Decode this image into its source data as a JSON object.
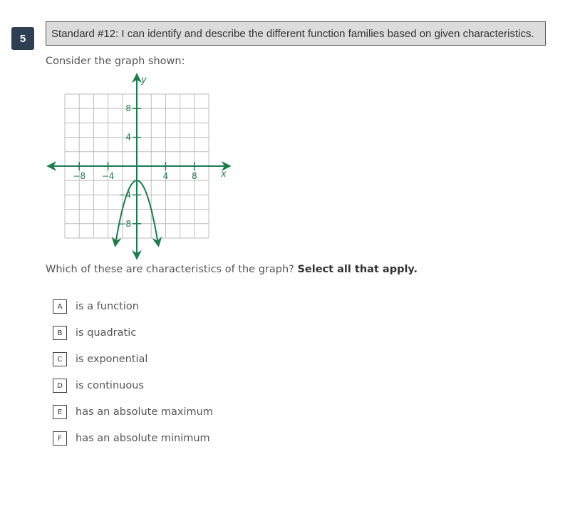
{
  "question": {
    "number": "5",
    "standard": "Standard #12: I can identify and describe the different function families based on given characteristics.",
    "prompt": "Consider the graph shown:",
    "question_text": "Which of these are characteristics of the graph? ",
    "question_emphasis": "Select all that apply.",
    "choices": [
      {
        "letter": "A",
        "text": "is a function"
      },
      {
        "letter": "B",
        "text": "is quadratic"
      },
      {
        "letter": "C",
        "text": "is exponential"
      },
      {
        "letter": "D",
        "text": "is continuous"
      },
      {
        "letter": "E",
        "text": "has an absolute maximum"
      },
      {
        "letter": "F",
        "text": "has an absolute minimum"
      }
    ]
  },
  "colors": {
    "axis": "#1f7a4f",
    "grid": "#bdbdbd",
    "badge": "#2e3f52"
  },
  "chart_data": {
    "type": "line",
    "title": "",
    "xlabel": "x",
    "ylabel": "y",
    "xlim": [
      -10,
      10
    ],
    "ylim": [
      -10,
      10
    ],
    "grid": true,
    "grid_step": 2,
    "x_ticks": [
      -8,
      -4,
      4,
      8
    ],
    "y_ticks": [
      8,
      4,
      -4,
      -8
    ],
    "x_tick_labels": [
      "−8",
      "−4",
      "4",
      "8"
    ],
    "y_tick_labels": [
      "8",
      "4",
      "−4",
      "−8"
    ],
    "series": [
      {
        "name": "parabola",
        "equation": "y = -x^2 - 2",
        "vertex": [
          0,
          -2
        ],
        "x_range": [
          -3,
          3
        ],
        "arrows_both_ends": true
      }
    ]
  }
}
